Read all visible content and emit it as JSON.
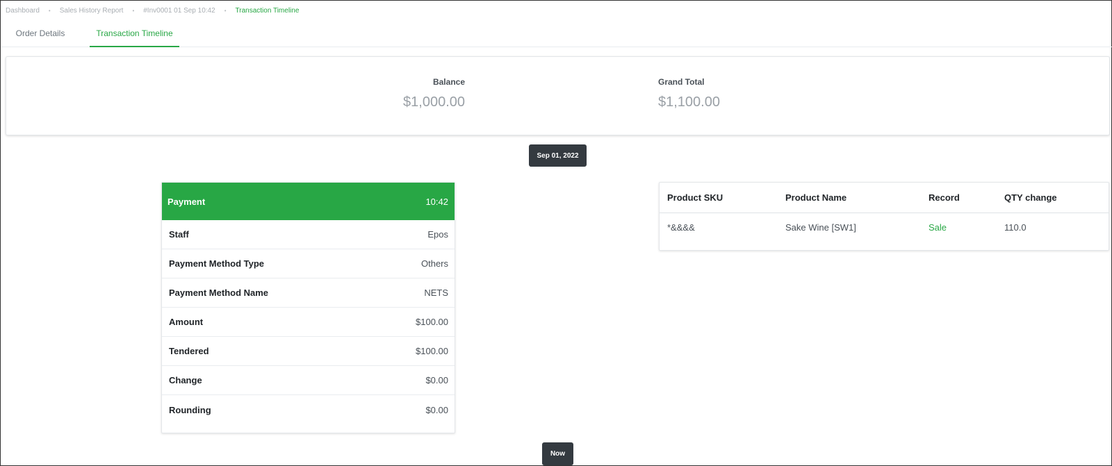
{
  "breadcrumb": {
    "items": [
      "Dashboard",
      "Sales History Report",
      "#Inv0001 01 Sep 10:42"
    ],
    "current": "Transaction Timeline",
    "separator": "•"
  },
  "tabs": [
    {
      "label": "Order Details",
      "active": false
    },
    {
      "label": "Transaction Timeline",
      "active": true
    }
  ],
  "summary": {
    "balance_label": "Balance",
    "balance_value": "$1,000.00",
    "grand_total_label": "Grand Total",
    "grand_total_value": "$1,100.00"
  },
  "timeline": {
    "date_chip": "Sep 01, 2022",
    "now_chip": "Now"
  },
  "payment": {
    "title": "Payment",
    "time": "10:42",
    "rows": [
      {
        "label": "Staff",
        "value": "Epos"
      },
      {
        "label": "Payment Method Type",
        "value": "Others"
      },
      {
        "label": "Payment Method Name",
        "value": "NETS"
      },
      {
        "label": "Amount",
        "value": "$100.00"
      },
      {
        "label": "Tendered",
        "value": "$100.00"
      },
      {
        "label": "Change",
        "value": "$0.00"
      },
      {
        "label": "Rounding",
        "value": "$0.00"
      }
    ]
  },
  "products": {
    "columns": [
      "Product SKU",
      "Product Name",
      "Record",
      "QTY change"
    ],
    "rows": [
      {
        "sku": "*&&&&",
        "name": "Sake Wine [SW1]",
        "record": "Sale",
        "qty": "110.0"
      }
    ]
  },
  "colors": {
    "accent": "#28a745",
    "chip": "#343a40"
  }
}
